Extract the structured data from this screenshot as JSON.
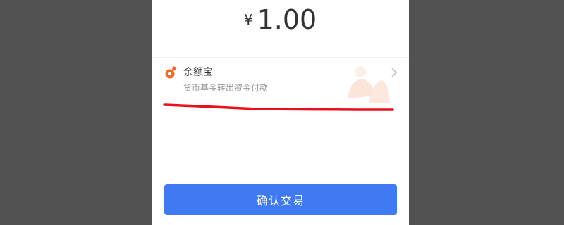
{
  "payment": {
    "currency_symbol": "¥",
    "amount": "1.00"
  },
  "method": {
    "name": "余额宝",
    "subtitle": "货币基金转出资金付款",
    "icon": "yuebao-icon",
    "chevron": "chevron-right-icon"
  },
  "confirm": {
    "label": "确认交易"
  },
  "colors": {
    "background": "#525252",
    "panel": "#ffffff",
    "button": "#3f7af3",
    "brand_orange": "#f06a2b",
    "annotation_red": "#e8111b"
  }
}
